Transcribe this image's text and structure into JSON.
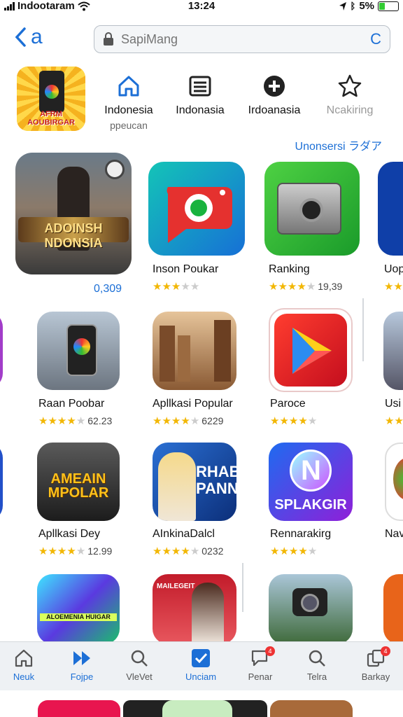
{
  "status": {
    "carrier": "Indootaram",
    "time": "13:24",
    "battery": "5%"
  },
  "nav": {
    "back_label": "a",
    "search_placeholder": "SapiMang"
  },
  "hero_app": {
    "label": "AFRM AOUBIRGAR"
  },
  "categories": [
    {
      "label": "Indonesia",
      "sub": "ppeucan",
      "icon": "home-icon"
    },
    {
      "label": "Indonasia",
      "sub": "",
      "icon": "list-icon"
    },
    {
      "label": "Irdoanasia",
      "sub": "",
      "icon": "plus-circle-icon"
    },
    {
      "label": "Ncakiring",
      "sub": "",
      "icon": "star-icon"
    }
  ],
  "see_all": "Unonsersi ラダア",
  "featured": {
    "title": "ADOINSH NDONSIA",
    "count": "0,309"
  },
  "rows": [
    [
      {
        "name": "Inson Poukar",
        "stars": 3,
        "rating": ""
      },
      {
        "name": "Ranking",
        "stars": 4,
        "rating": "19,39"
      },
      {
        "name": "Uop",
        "stars": 2,
        "rating": ""
      }
    ],
    [
      {
        "name": "Raan Poobar",
        "stars": 4,
        "rating": "62.23"
      },
      {
        "name": "Apllkasi Popular",
        "stars": 4,
        "rating": "6229"
      },
      {
        "name": "Paroce",
        "stars": 4,
        "rating": ""
      },
      {
        "name": "Usi",
        "stars": 2,
        "rating": ""
      }
    ],
    [
      {
        "name": "Apllkasi Dey",
        "stars": 4,
        "rating": "12.99",
        "tile_text": "AMEAIN MPOLAR"
      },
      {
        "name": "AInkinaDalcl",
        "stars": 4,
        "rating": "0232",
        "tile_text": "RHABN PANN"
      },
      {
        "name": "Rennarakirg",
        "stars": 4,
        "rating": "",
        "tile_text": "SPLAKGIR"
      },
      {
        "name": "Nav",
        "stars": 0,
        "rating": ""
      }
    ]
  ],
  "row4_tiles": [
    {
      "tile_text": "ALOEMENIA HUIGAR"
    },
    {
      "tile_text": "MAILEGEIT"
    }
  ],
  "tabs": [
    {
      "label": "Neuk",
      "icon": "home-icon"
    },
    {
      "label": "Fojpe",
      "icon": "fast-forward-icon"
    },
    {
      "label": "VleVet",
      "icon": "search-icon"
    },
    {
      "label": "Unciam",
      "icon": "checkbox-icon"
    },
    {
      "label": "Penar",
      "icon": "chat-icon",
      "badge": "4"
    },
    {
      "label": "Telra",
      "icon": "search-icon"
    },
    {
      "label": "Barkay",
      "icon": "copy-icon",
      "badge": "4"
    }
  ],
  "colors": {
    "accent": "#1c6fd6",
    "star": "#f2b705"
  }
}
